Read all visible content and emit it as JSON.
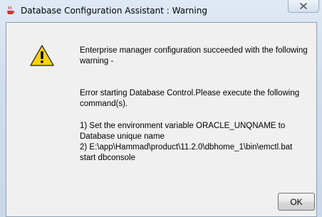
{
  "window": {
    "title": "Database Configuration Assistant : Warning"
  },
  "dialog": {
    "message_line1": "Enterprise manager configuration succeeded with the following warning -",
    "message_line2": "Error starting Database Control.Please execute the following command(s).",
    "message_line3": " 1) Set the environment variable ORACLE_UNQNAME to Database unique name\n 2) E:\\app\\Hammad\\product\\11.2.0\\dbhome_1\\bin\\emctl.bat start dbconsole",
    "ok_label": "OK"
  },
  "colors": {
    "warning_yellow": "#ffd400",
    "content_bg": "#f0f0f0"
  },
  "icons": {
    "title": "java-cup-icon",
    "warning": "warning-icon",
    "close": "close-icon"
  }
}
